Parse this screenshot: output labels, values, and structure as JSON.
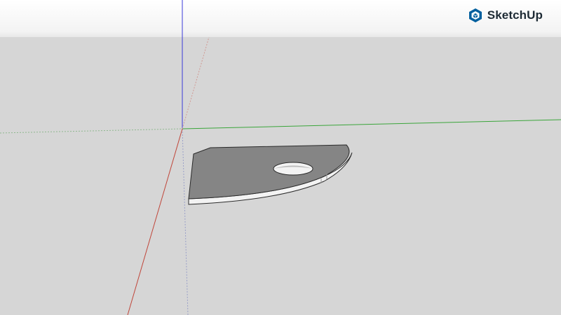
{
  "app": {
    "logo_text": "SketchUp"
  },
  "colors": {
    "sky_top": "#ffffff",
    "ground": "#d6d6d6",
    "axis_red": "#c0463a",
    "axis_green": "#3aa53a",
    "axis_blue": "#3a3ad8",
    "model_face_top": "#838383",
    "model_face_side": "#f2f2f2",
    "logo_brand": "#005f9e"
  },
  "icons": {
    "logo": "sketchup-logo-icon"
  }
}
